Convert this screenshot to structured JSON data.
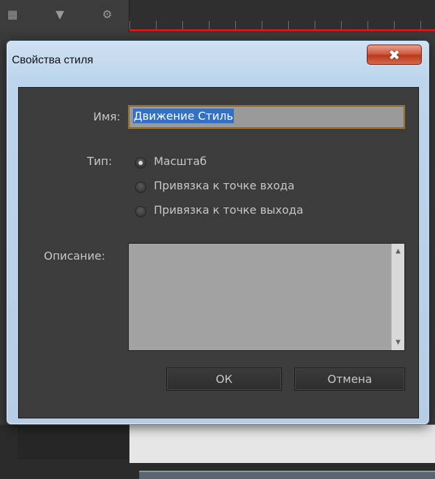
{
  "dialog": {
    "title": "Свойства стиля",
    "close_icon": "close-icon"
  },
  "form": {
    "name_label": "Имя:",
    "name_value": "Движение Стиль",
    "type_label": "Тип:",
    "type_options": [
      {
        "label": "Масштаб",
        "checked": true
      },
      {
        "label": "Привязка к точке входа",
        "checked": false
      },
      {
        "label": "Привязка к точке выхода",
        "checked": false
      }
    ],
    "description_label": "Описание:",
    "description_value": ""
  },
  "buttons": {
    "ok_label": "ОК",
    "cancel_label": "Отмена"
  },
  "colors": {
    "timeline_marker": "#d21b1b",
    "selection": "#3470c4",
    "input_focus": "#ad7e2e",
    "close_button": "#c9462a"
  }
}
